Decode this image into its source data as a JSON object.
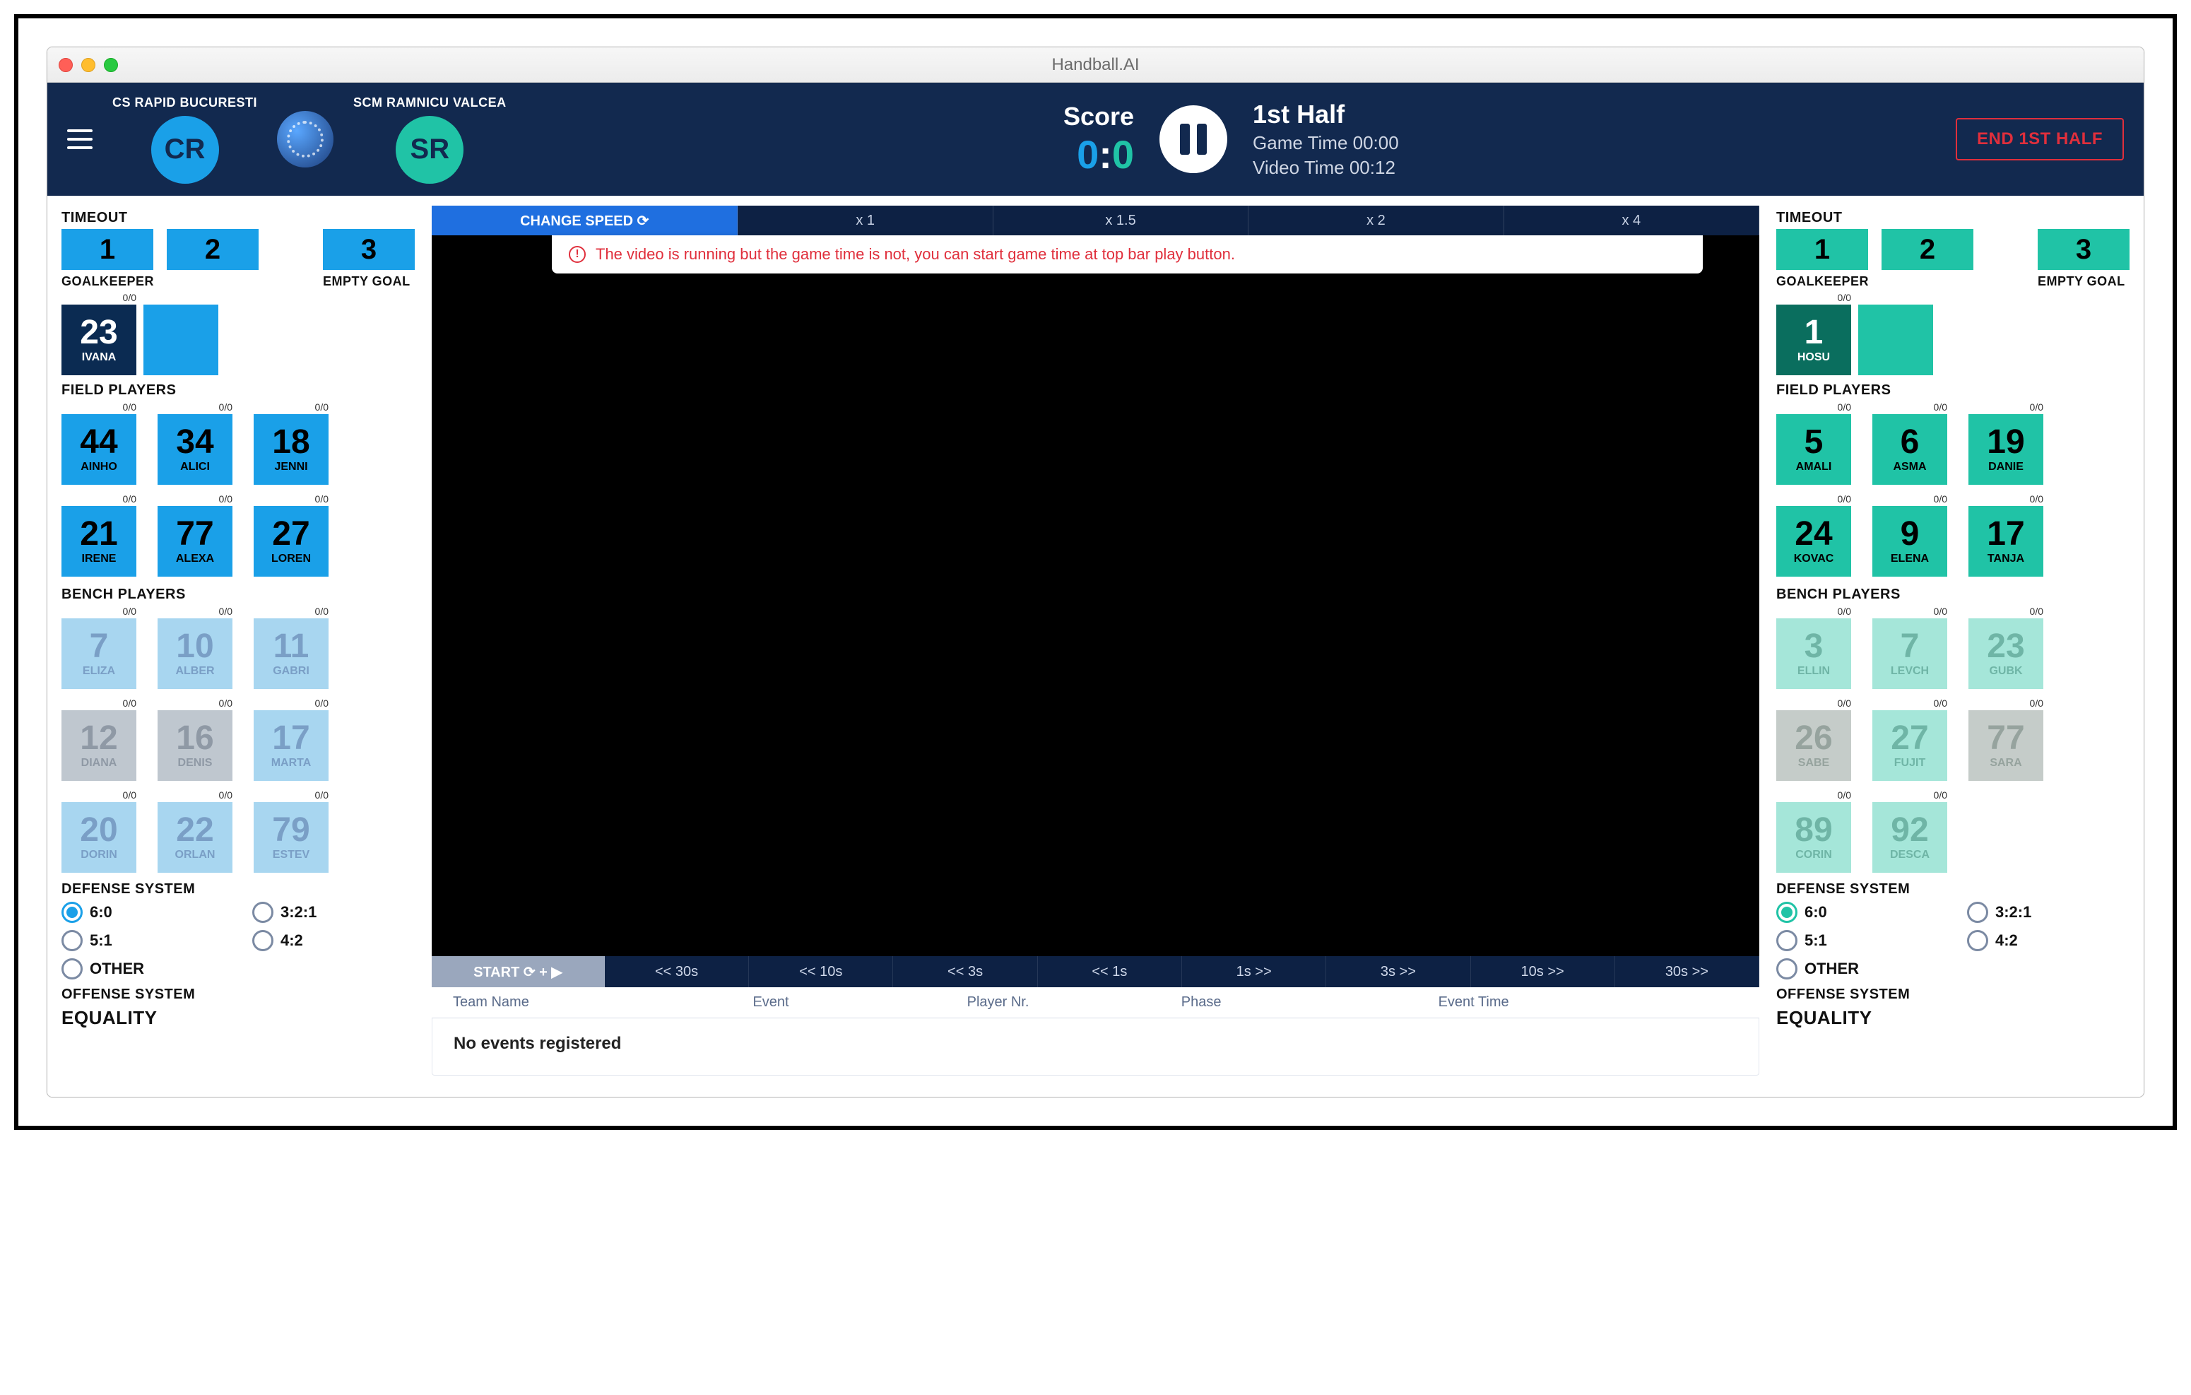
{
  "window": {
    "title": "Handball.AI"
  },
  "header": {
    "team_home": {
      "name": "CS RAPID BUCURESTI",
      "abbrev": "CR"
    },
    "team_away": {
      "name": "SCM RAMNICU VALCEA",
      "abbrev": "SR"
    },
    "score_label": "Score",
    "score_home": "0",
    "score_away": "0",
    "half_title": "1st Half",
    "game_time_label": "Game Time 00:00",
    "video_time_label": "Video Time 00:12",
    "end_half_label": "END 1ST HALF"
  },
  "speed_bar": {
    "change_label": "CHANGE SPEED ⟳",
    "x1": "x 1",
    "x15": "x 1.5",
    "x2": "x 2",
    "x4": "x 4"
  },
  "alert": {
    "text": "The video is running but the game time is not, you can start game time at top bar play button."
  },
  "seek": {
    "start": "START ⟳ + ▶",
    "b30": "<< 30s",
    "b10": "<< 10s",
    "b3": "<< 3s",
    "b1": "<< 1s",
    "f1": "1s >>",
    "f3": "3s >>",
    "f10": "10s >>",
    "f30": "30s >>"
  },
  "events": {
    "cols": {
      "team": "Team Name",
      "event": "Event",
      "player": "Player Nr.",
      "phase": "Phase",
      "time": "Event Time"
    },
    "empty": "No events registered"
  },
  "labels": {
    "timeout": "TIMEOUT",
    "goalkeeper": "GOALKEEPER",
    "empty_goal": "EMPTY GOAL",
    "field_players": "FIELD PLAYERS",
    "bench_players": "BENCH PLAYERS",
    "defense_system": "DEFENSE SYSTEM",
    "offense_system": "OFFENSE SYSTEM",
    "other": "OTHER",
    "equality": "EQUALITY",
    "stat": "0/0"
  },
  "timeout_numbers": {
    "t1": "1",
    "t2": "2",
    "t3": "3"
  },
  "defense_options": {
    "d60": "6:0",
    "d321": "3:2:1",
    "d51": "5:1",
    "d42": "4:2"
  },
  "home": {
    "gk": {
      "num": "23",
      "name": "IVANA"
    },
    "field": [
      {
        "num": "44",
        "name": "AINHO"
      },
      {
        "num": "34",
        "name": "ALICI"
      },
      {
        "num": "18",
        "name": "JENNI"
      },
      {
        "num": "21",
        "name": "IRENE"
      },
      {
        "num": "77",
        "name": "ALEXA"
      },
      {
        "num": "27",
        "name": "LOREN"
      }
    ],
    "bench": [
      {
        "num": "7",
        "name": "ELIZA",
        "shade": "bench"
      },
      {
        "num": "10",
        "name": "ALBER",
        "shade": "bench"
      },
      {
        "num": "11",
        "name": "GABRI",
        "shade": "bench"
      },
      {
        "num": "12",
        "name": "DIANA",
        "shade": "bench2"
      },
      {
        "num": "16",
        "name": "DENIS",
        "shade": "bench2"
      },
      {
        "num": "17",
        "name": "MARTA",
        "shade": "bench"
      },
      {
        "num": "20",
        "name": "DORIN",
        "shade": "bench"
      },
      {
        "num": "22",
        "name": "ORLAN",
        "shade": "bench"
      },
      {
        "num": "79",
        "name": "ESTEV",
        "shade": "bench"
      }
    ]
  },
  "away": {
    "gk": {
      "num": "1",
      "name": "HOSU"
    },
    "field": [
      {
        "num": "5",
        "name": "AMALI"
      },
      {
        "num": "6",
        "name": "ASMA"
      },
      {
        "num": "19",
        "name": "DANIE"
      },
      {
        "num": "24",
        "name": "KOVAC"
      },
      {
        "num": "9",
        "name": "ELENA"
      },
      {
        "num": "17",
        "name": "TANJA"
      }
    ],
    "bench": [
      {
        "num": "3",
        "name": "ELLIN",
        "shade": "bench"
      },
      {
        "num": "7",
        "name": "LEVCH",
        "shade": "bench"
      },
      {
        "num": "23",
        "name": "GUBK",
        "shade": "bench"
      },
      {
        "num": "26",
        "name": "SABE",
        "shade": "bench2"
      },
      {
        "num": "27",
        "name": "FUJIT",
        "shade": "bench"
      },
      {
        "num": "77",
        "name": "SARA",
        "shade": "bench2"
      },
      {
        "num": "89",
        "name": "CORIN",
        "shade": "bench"
      },
      {
        "num": "92",
        "name": "DESCA",
        "shade": "bench"
      }
    ]
  }
}
